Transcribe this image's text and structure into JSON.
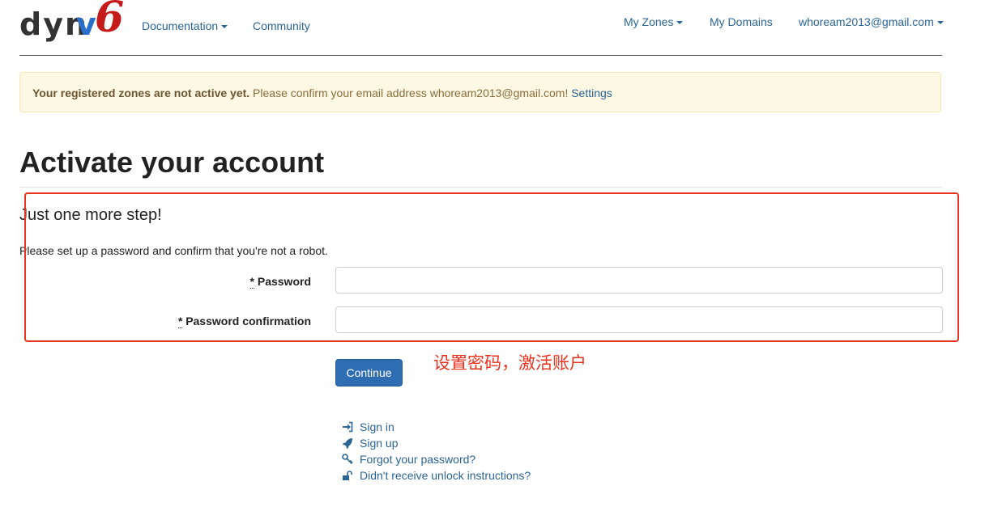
{
  "brand": {
    "part1": "dyn",
    "part2": "v",
    "part3": "6"
  },
  "nav": {
    "documentation": "Documentation",
    "community": "Community",
    "my_zones": "My Zones",
    "my_domains": "My Domains",
    "account_email": "whoream2013@gmail.com"
  },
  "alert": {
    "bold_text": "Your registered zones are not active yet.",
    "text": " Please confirm your email address whoream2013@gmail.com! ",
    "link": "Settings"
  },
  "page": {
    "title": "Activate your account",
    "subtitle": "Just one more step!",
    "description": "Please set up a password and confirm that you're not a robot."
  },
  "form": {
    "required_mark": "*",
    "password_label": "Password",
    "password_value": "",
    "password_confirmation_label": "Password confirmation",
    "password_confirmation_value": "",
    "submit_label": "Continue"
  },
  "annotation": {
    "text": "设置密码，激活账户",
    "color": "#e8321e"
  },
  "links": [
    {
      "label": "Sign in",
      "icon": "sign-in-icon"
    },
    {
      "label": "Sign up",
      "icon": "rocket-icon"
    },
    {
      "label": "Forgot your password?",
      "icon": "key-icon"
    },
    {
      "label": "Didn't receive unlock instructions?",
      "icon": "unlock-icon"
    }
  ],
  "colors": {
    "link": "#2a6496",
    "primary_button": "#2f6db3",
    "alert_bg": "#fcf8e3",
    "brand_blue": "#2a6fc9",
    "brand_red": "#c41a1a"
  }
}
